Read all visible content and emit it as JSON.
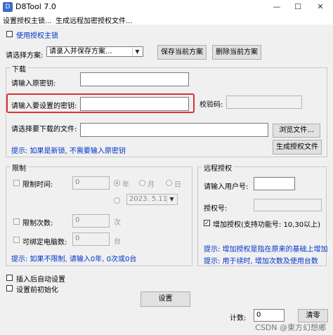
{
  "window": {
    "title": "D8Tool 7.0",
    "minimize_glyph": "—",
    "maximize_glyph": "☐",
    "close_glyph": "✕",
    "icon_glyph": "D"
  },
  "menu": {
    "items": [
      "设置授权主锁...",
      "生成远程加密授权文件..."
    ]
  },
  "use_master_lock": {
    "label": "使用授权主锁",
    "checked": false
  },
  "scheme": {
    "label": "请选择方案:",
    "value": "请录入并保存方案...",
    "save_button": "保存当前方案",
    "delete_button": "删除当前方案"
  },
  "download": {
    "group_title": "下载",
    "original_key_label": "请输入原密钥:",
    "new_key_label": "请输入要设置的密钥:",
    "checksum_label": "校验码:",
    "file_label": "请选择要下载的文件:",
    "browse_button": "浏览文件...",
    "hint": "提示: 如果是新锁, 不需要输入原密钥",
    "generate_button": "生成授权文件"
  },
  "limits": {
    "group_title": "限制",
    "time_label": "限制时间:",
    "time_value": "0",
    "radio_year": "年",
    "radio_month": "月",
    "radio_day": "日",
    "date_value": "2023. 5.11",
    "count_label": "限制次数:",
    "count_value": "0",
    "count_unit": "次",
    "machines_label": "可绑定电脑数:",
    "machines_value": "0",
    "machines_unit": "台",
    "hint": "提示: 如果不限制, 请输入0年, 0次或0台"
  },
  "remote": {
    "group_title": "远程授权",
    "user_no_label": "请输入用户号:",
    "auth_no_label": "授权号:",
    "increase_label": "增加授权(支持功能号: 10,30以上)",
    "increase_checked": true,
    "hint1": "提示: 增加授权是指在原来的基础上增加",
    "hint2": "提示: 用于续时, 增加次数及使用台数"
  },
  "options": {
    "auto_after_insert": "插入后自动设置",
    "init_before_set": "设置前初始化"
  },
  "setup_button": "设置",
  "counter": {
    "label": "计数:",
    "value": "0",
    "clear_button": "清零"
  },
  "watermark": "CSDN @東方幻想鄉"
}
